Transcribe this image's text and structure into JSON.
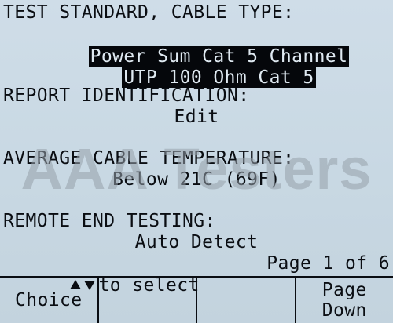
{
  "test_standard": {
    "heading": "TEST STANDARD, CABLE TYPE:",
    "standard": "Power Sum Cat 5 Channel",
    "cable_type": "UTP 100 Ohm Cat 5"
  },
  "report_identification": {
    "heading": "REPORT IDENTIFICATION:",
    "value": "Edit"
  },
  "average_cable_temperature": {
    "heading": "AVERAGE CABLE TEMPERATURE:",
    "value": "Below 21C (69F)"
  },
  "remote_end_testing": {
    "heading": "REMOTE END TESTING:",
    "value": "Auto Detect"
  },
  "watermark": "AAA Testers",
  "status": {
    "select_hint": "to select",
    "up_icon": "up-triangle-icon",
    "down_icon": "down-triangle-icon",
    "page": "Page 1 of 6"
  },
  "softkeys": [
    {
      "label": "Choice"
    },
    {
      "label": ""
    },
    {
      "label": ""
    },
    {
      "label": "Page\nDown"
    }
  ]
}
